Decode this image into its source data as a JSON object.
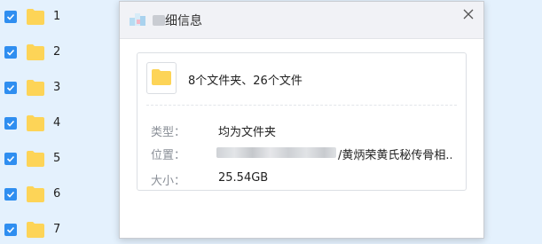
{
  "file_list": {
    "rows": [
      {
        "name": "1",
        "checked": true
      },
      {
        "name": "2",
        "checked": true
      },
      {
        "name": "3",
        "checked": true
      },
      {
        "name": "4",
        "checked": true
      },
      {
        "name": "5",
        "checked": true
      },
      {
        "name": "6",
        "checked": true
      },
      {
        "name": "7",
        "checked": true
      }
    ]
  },
  "dialog": {
    "title": "细信息",
    "summary": "8个文件夹、26个文件",
    "properties": {
      "type_label": "类型：",
      "type_value": "均为文件夹",
      "location_label": "位置：",
      "location_value": "/黄炳荣黄氏秘传骨相...",
      "size_label": "大小：",
      "size_value": "25.54GB"
    }
  },
  "colors": {
    "accent": "#2f8ef0",
    "folder": "#fdd457",
    "list_bg": "#e4f1fd"
  },
  "icons": {
    "row_checkbox": "checkbox-checked-icon",
    "row_folder": "folder-icon",
    "dialog_close": "close-icon",
    "dialog_app": "app-icon"
  }
}
